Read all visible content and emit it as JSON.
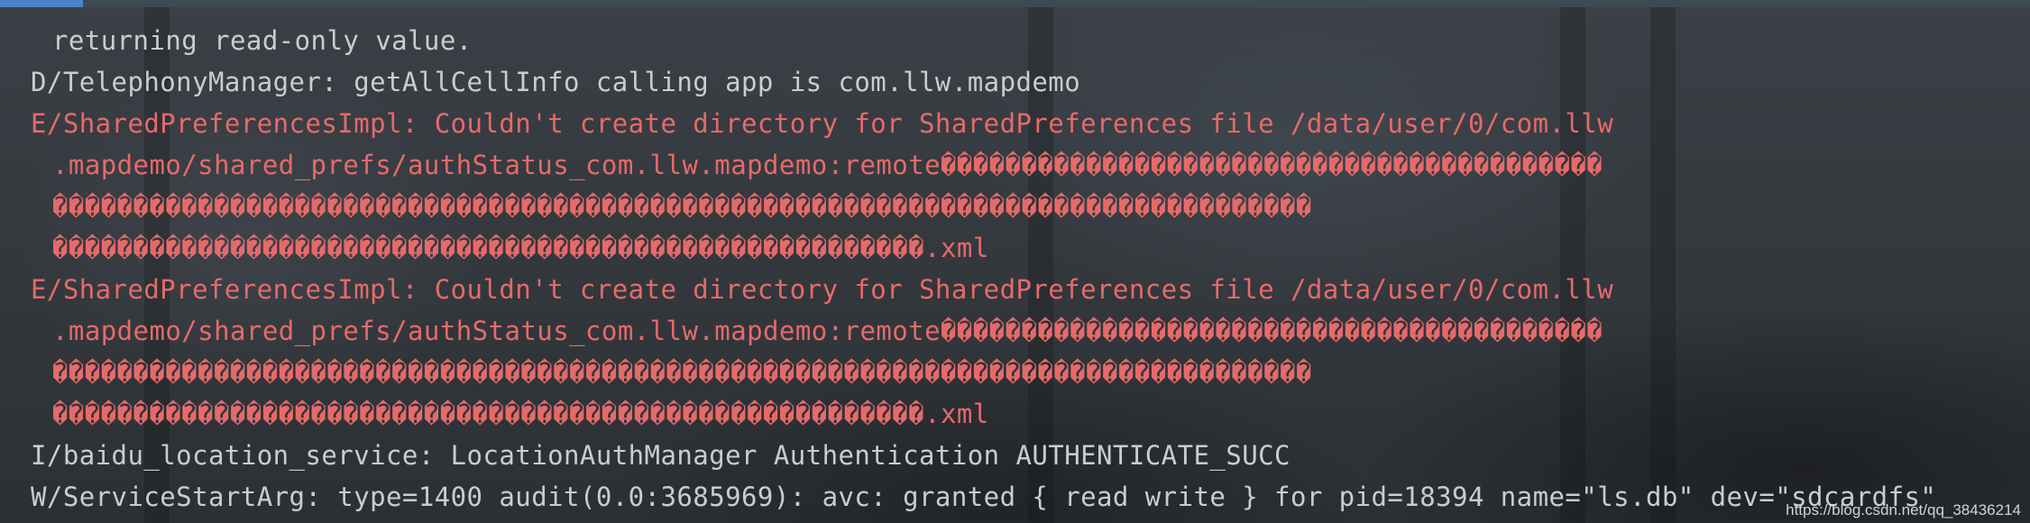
{
  "log_lines": [
    {
      "level": "D",
      "text": "returning read-only value.",
      "continuation": true
    },
    {
      "level": "D",
      "text": "D/TelephonyManager: getAllCellInfo calling app is com.llw.mapdemo",
      "continuation": false
    },
    {
      "level": "E",
      "text": "E/SharedPreferencesImpl: Couldn't create directory for SharedPreferences file /data/user/0/com.llw",
      "continuation": false
    },
    {
      "level": "E",
      "text": ".mapdemo/shared_prefs/authStatus_com.llw.mapdemo:remote�����������������������������������������",
      "continuation": true
    },
    {
      "level": "E",
      "text": "������������������������������������������������������������������������������",
      "continuation": true
    },
    {
      "level": "E",
      "text": "������������������������������������������������������.xml",
      "continuation": true
    },
    {
      "level": "E",
      "text": "E/SharedPreferencesImpl: Couldn't create directory for SharedPreferences file /data/user/0/com.llw",
      "continuation": false
    },
    {
      "level": "E",
      "text": ".mapdemo/shared_prefs/authStatus_com.llw.mapdemo:remote�����������������������������������������",
      "continuation": true
    },
    {
      "level": "E",
      "text": "������������������������������������������������������������������������������",
      "continuation": true
    },
    {
      "level": "E",
      "text": "������������������������������������������������������.xml",
      "continuation": true
    },
    {
      "level": "I",
      "text": "I/baidu_location_service: LocationAuthManager Authentication AUTHENTICATE_SUCC",
      "continuation": false
    },
    {
      "level": "W",
      "text": "W/ServiceStartArg: type=1400 audit(0.0:3685969): avc: granted { read write } for pid=18394 name=\"ls.db\" dev=\"sdcardfs\"",
      "continuation": false
    }
  ],
  "watermark": "https://blog.csdn.net/qq_38436214",
  "colors": {
    "error_text": "#e66a6a",
    "default_text": "#c9cdd1",
    "background": "#2f3438",
    "tab_accent": "#4a84c9"
  }
}
